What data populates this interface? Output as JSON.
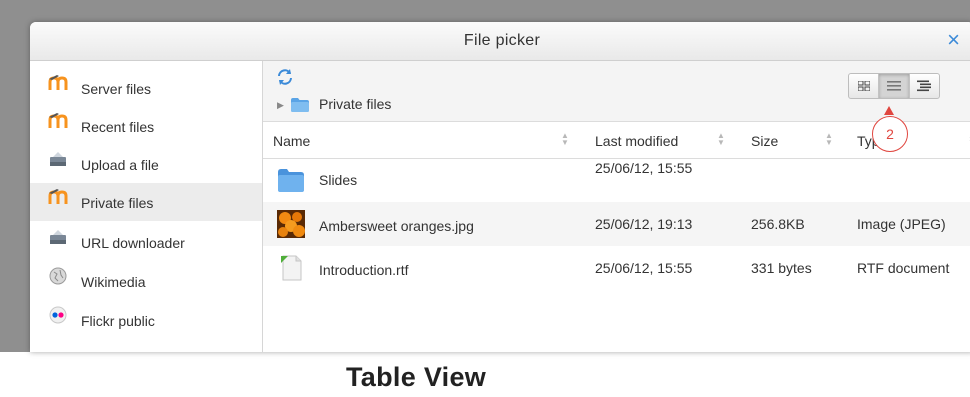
{
  "dialog": {
    "title": "File picker",
    "close_label": "×"
  },
  "sidebar": {
    "items": [
      {
        "label": "Server files",
        "icon": "moodle-icon"
      },
      {
        "label": "Recent files",
        "icon": "moodle-icon"
      },
      {
        "label": "Upload a file",
        "icon": "upload-icon"
      },
      {
        "label": "Private files",
        "icon": "moodle-icon",
        "active": true
      },
      {
        "label": "URL downloader",
        "icon": "url-icon"
      },
      {
        "label": "Wikimedia",
        "icon": "wikimedia-icon"
      },
      {
        "label": "Flickr public",
        "icon": "flickr-icon"
      }
    ]
  },
  "toolbar": {
    "refresh_icon": "refresh-icon",
    "breadcrumb": "Private files",
    "view_buttons": [
      "icon-view",
      "table-view",
      "tree-view"
    ],
    "active_view": "table-view",
    "marker": "2"
  },
  "table": {
    "columns": [
      "Name",
      "Last modified",
      "Size",
      "Type"
    ],
    "rows": [
      {
        "name": "Slides",
        "modified": "25/06/12, 15:55",
        "size": "",
        "type": "",
        "icon": "folder-icon"
      },
      {
        "name": "Ambersweet oranges.jpg",
        "modified": "25/06/12, 19:13",
        "size": "256.8KB",
        "type": "Image (JPEG)",
        "icon": "image-thumbnail-icon"
      },
      {
        "name": "Introduction.rtf",
        "modified": "25/06/12, 15:55",
        "size": "331 bytes",
        "type": "RTF document",
        "icon": "document-icon"
      }
    ]
  },
  "caption": "Table View",
  "colors": {
    "accent": "#3b8ad8",
    "marker": "#e0463f",
    "moodle_orange": "#f7931e"
  }
}
